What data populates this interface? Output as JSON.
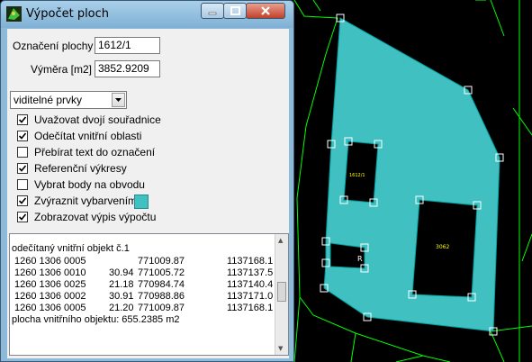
{
  "window": {
    "title": "Výpočet ploch"
  },
  "colors": {
    "fill": "#40c0c0",
    "drawing_bg": "#000000",
    "linework": "#00ff00",
    "marker": "#ffffff"
  },
  "form": {
    "parcel_label": "Označení plochy",
    "parcel_value": "1612/1",
    "area_label": "Výměra [m2]",
    "area_value": "3852.9209",
    "combo_value": "viditelné prvky"
  },
  "options": [
    {
      "label": "Uvažovat dvojí souřadnice",
      "checked": true
    },
    {
      "label": "Odečítat vnitřní oblasti",
      "checked": true
    },
    {
      "label": "Přebírat text do označení",
      "checked": false
    },
    {
      "label": "Referenční výkresy",
      "checked": true
    },
    {
      "label": "Vybrat body na obvodu",
      "checked": false
    },
    {
      "label": "Zvýraznit vybarvením",
      "checked": true
    },
    {
      "label": "Zobrazovat výpis výpočtu",
      "checked": true
    }
  ],
  "output": {
    "heading": "odečítaný vnitřní objekt č.1",
    "rows": [
      {
        "id": "1260 1306 0005",
        "dist": "",
        "y": "771009.87",
        "x": "1137168.1"
      },
      {
        "id": "1260 1306 0010",
        "dist": "30.94",
        "y": "771005.72",
        "x": "1137137.5"
      },
      {
        "id": "1260 1306 0025",
        "dist": "21.18",
        "y": "770984.74",
        "x": "1137140.4"
      },
      {
        "id": "1260 1306 0002",
        "dist": "30.91",
        "y": "770988.86",
        "x": "1137171.0"
      },
      {
        "id": "1260 1306 0005",
        "dist": "21.20",
        "y": "771009.87",
        "x": "1137168.1"
      }
    ],
    "footer": "plocha vnitřního objektu:  655.2385 m2"
  },
  "drawing": {
    "labels": {
      "l1": "3062",
      "l2": "R",
      "l3": "1612/1"
    }
  }
}
